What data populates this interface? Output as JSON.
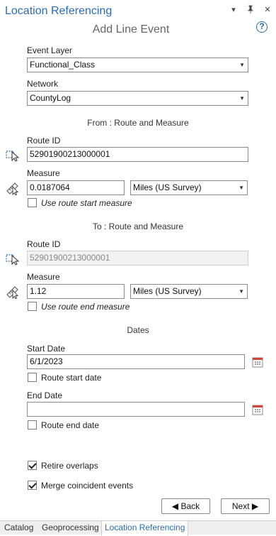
{
  "pane": {
    "title": "Location Referencing",
    "subtitle": "Add Line Event",
    "help": "?"
  },
  "titlebar_icons": [
    "chevron-down-icon",
    "pin-icon",
    "close-icon"
  ],
  "event_layer": {
    "label": "Event Layer",
    "value": "Functional_Class"
  },
  "network": {
    "label": "Network",
    "value": "CountyLog"
  },
  "from": {
    "section": "From : Route and Measure",
    "route_label": "Route ID",
    "route_value": "52901900213000001",
    "measure_label": "Measure",
    "measure_value": "0.0187064",
    "units": "Miles (US Survey)",
    "use_measure_label": "Use route start measure",
    "use_measure_checked": false
  },
  "to": {
    "section": "To : Route and Measure",
    "route_label": "Route ID",
    "route_value": "52901900213000001",
    "measure_label": "Measure",
    "measure_value": "1.12",
    "units": "Miles (US Survey)",
    "use_measure_label": "Use route end measure",
    "use_measure_checked": false
  },
  "dates": {
    "section": "Dates",
    "start_label": "Start Date",
    "start_value": "6/1/2023",
    "route_start_label": "Route start date",
    "route_start_checked": false,
    "end_label": "End Date",
    "end_value": "",
    "route_end_label": "Route end date",
    "route_end_checked": false
  },
  "options": {
    "retire_label": "Retire overlaps",
    "retire_checked": true,
    "merge_label": "Merge coincident events",
    "merge_checked": true
  },
  "buttons": {
    "back": "◀ Back",
    "next": "Next ▶"
  },
  "tabs": [
    "Catalog",
    "Geoprocessing",
    "Location Referencing"
  ],
  "active_tab": "Location Referencing",
  "colors": {
    "accent": "#2b6cb5"
  }
}
